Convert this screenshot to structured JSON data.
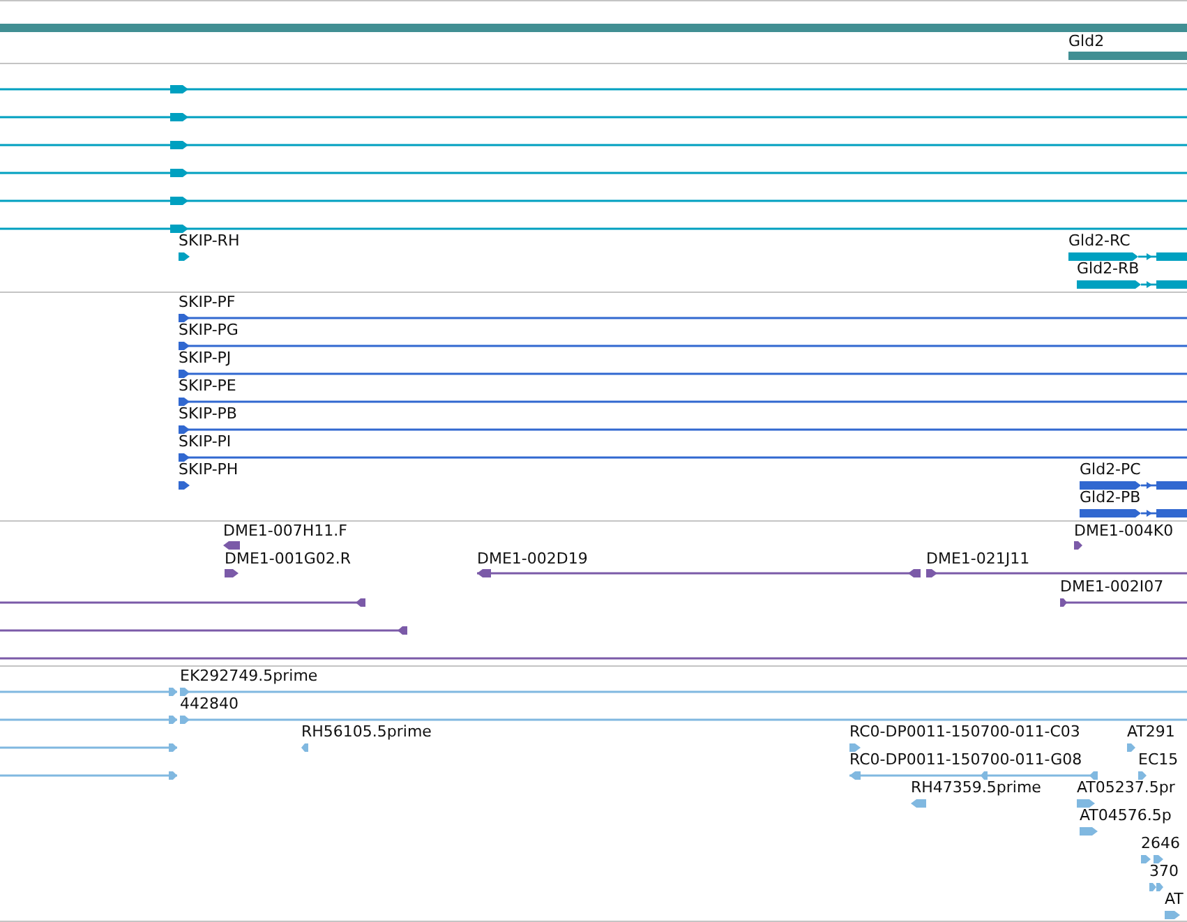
{
  "tracks": [
    {
      "kind": "gene",
      "features": [
        {
          "kind": "bar"
        },
        {
          "kind": "bar",
          "label": "Gld2"
        }
      ]
    },
    {
      "kind": "transcript",
      "features": [
        {
          "kind": "line",
          "reverse": false
        },
        {
          "kind": "line",
          "reverse": false
        },
        {
          "kind": "line",
          "reverse": false
        },
        {
          "kind": "line",
          "reverse": false
        },
        {
          "kind": "line",
          "reverse": false
        },
        {
          "kind": "line",
          "reverse": false
        },
        {
          "kind": "block",
          "reverse": false,
          "label": "SKIP-RH"
        },
        {
          "kind": "exons",
          "reverse": false,
          "label": "Gld2-RC"
        },
        {
          "kind": "exons",
          "reverse": false,
          "label": "Gld2-RB"
        }
      ]
    },
    {
      "kind": "protein",
      "features": [
        {
          "kind": "line",
          "reverse": false,
          "label": "SKIP-PF"
        },
        {
          "kind": "line",
          "reverse": false,
          "label": "SKIP-PG"
        },
        {
          "kind": "line",
          "reverse": false,
          "label": "SKIP-PJ"
        },
        {
          "kind": "line",
          "reverse": false,
          "label": "SKIP-PE"
        },
        {
          "kind": "line",
          "reverse": false,
          "label": "SKIP-PB"
        },
        {
          "kind": "line",
          "reverse": false,
          "label": "SKIP-PI"
        },
        {
          "kind": "block",
          "reverse": false,
          "label": "SKIP-PH"
        },
        {
          "kind": "exons",
          "reverse": false,
          "label": "Gld2-PC"
        },
        {
          "kind": "exons",
          "reverse": false,
          "label": "Gld2-PB"
        }
      ]
    },
    {
      "kind": "clone",
      "features": [
        {
          "kind": "block",
          "reverse": true,
          "label": "DME1-007H11.F"
        },
        {
          "kind": "block",
          "reverse": false,
          "label": "DME1-001G02.R"
        },
        {
          "kind": "line",
          "reverse": true,
          "label": "DME1-002D19"
        },
        {
          "kind": "line",
          "reverse": false,
          "label": "DME1-021J11"
        },
        {
          "kind": "block",
          "reverse": false,
          "label": "DME1-004K0"
        },
        {
          "kind": "line",
          "reverse": false,
          "label": "DME1-002I07"
        },
        {
          "kind": "line",
          "reverse": true
        },
        {
          "kind": "line",
          "reverse": true
        },
        {
          "kind": "line"
        }
      ]
    },
    {
      "kind": "est",
      "features": [
        {
          "kind": "line",
          "reverse": false
        },
        {
          "kind": "line",
          "reverse": false
        },
        {
          "kind": "line",
          "reverse": false
        },
        {
          "kind": "line",
          "reverse": false
        },
        {
          "kind": "line",
          "reverse": false,
          "label": "EK292749.5prime"
        },
        {
          "kind": "line",
          "reverse": false,
          "label": "442840"
        },
        {
          "kind": "block",
          "reverse": true,
          "label": "RH56105.5prime"
        },
        {
          "kind": "block",
          "reverse": false,
          "label": "RC0-DP0011-150700-011-C03"
        },
        {
          "kind": "block",
          "reverse": false,
          "label": "AT291"
        },
        {
          "kind": "line",
          "reverse": true,
          "label": "RC0-DP0011-150700-011-G08"
        },
        {
          "kind": "block",
          "reverse": false,
          "label": "EC15"
        },
        {
          "kind": "block",
          "reverse": true,
          "label": "RH47359.5prime"
        },
        {
          "kind": "block",
          "reverse": false,
          "label": "AT05237.5pr"
        },
        {
          "kind": "block",
          "reverse": false,
          "label": "AT04576.5p"
        },
        {
          "kind": "block",
          "reverse": false,
          "label": "2646"
        },
        {
          "kind": "block",
          "reverse": false,
          "label": "370"
        },
        {
          "kind": "block",
          "reverse": false,
          "label": "AT"
        }
      ]
    }
  ]
}
